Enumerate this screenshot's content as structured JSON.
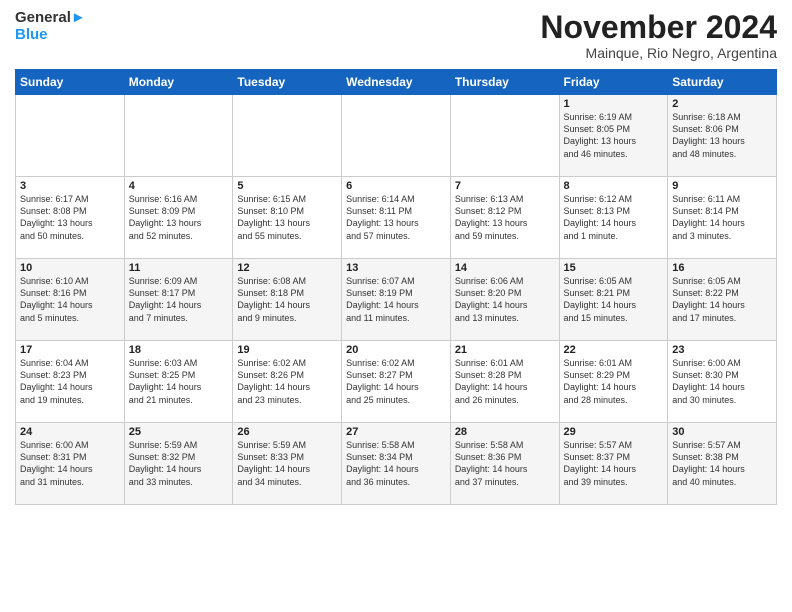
{
  "logo": {
    "line1": "General",
    "line2": "Blue"
  },
  "title": "November 2024",
  "subtitle": "Mainque, Rio Negro, Argentina",
  "days_header": [
    "Sunday",
    "Monday",
    "Tuesday",
    "Wednesday",
    "Thursday",
    "Friday",
    "Saturday"
  ],
  "weeks": [
    [
      {
        "day": "",
        "info": ""
      },
      {
        "day": "",
        "info": ""
      },
      {
        "day": "",
        "info": ""
      },
      {
        "day": "",
        "info": ""
      },
      {
        "day": "",
        "info": ""
      },
      {
        "day": "1",
        "info": "Sunrise: 6:19 AM\nSunset: 8:05 PM\nDaylight: 13 hours\nand 46 minutes."
      },
      {
        "day": "2",
        "info": "Sunrise: 6:18 AM\nSunset: 8:06 PM\nDaylight: 13 hours\nand 48 minutes."
      }
    ],
    [
      {
        "day": "3",
        "info": "Sunrise: 6:17 AM\nSunset: 8:08 PM\nDaylight: 13 hours\nand 50 minutes."
      },
      {
        "day": "4",
        "info": "Sunrise: 6:16 AM\nSunset: 8:09 PM\nDaylight: 13 hours\nand 52 minutes."
      },
      {
        "day": "5",
        "info": "Sunrise: 6:15 AM\nSunset: 8:10 PM\nDaylight: 13 hours\nand 55 minutes."
      },
      {
        "day": "6",
        "info": "Sunrise: 6:14 AM\nSunset: 8:11 PM\nDaylight: 13 hours\nand 57 minutes."
      },
      {
        "day": "7",
        "info": "Sunrise: 6:13 AM\nSunset: 8:12 PM\nDaylight: 13 hours\nand 59 minutes."
      },
      {
        "day": "8",
        "info": "Sunrise: 6:12 AM\nSunset: 8:13 PM\nDaylight: 14 hours\nand 1 minute."
      },
      {
        "day": "9",
        "info": "Sunrise: 6:11 AM\nSunset: 8:14 PM\nDaylight: 14 hours\nand 3 minutes."
      }
    ],
    [
      {
        "day": "10",
        "info": "Sunrise: 6:10 AM\nSunset: 8:16 PM\nDaylight: 14 hours\nand 5 minutes."
      },
      {
        "day": "11",
        "info": "Sunrise: 6:09 AM\nSunset: 8:17 PM\nDaylight: 14 hours\nand 7 minutes."
      },
      {
        "day": "12",
        "info": "Sunrise: 6:08 AM\nSunset: 8:18 PM\nDaylight: 14 hours\nand 9 minutes."
      },
      {
        "day": "13",
        "info": "Sunrise: 6:07 AM\nSunset: 8:19 PM\nDaylight: 14 hours\nand 11 minutes."
      },
      {
        "day": "14",
        "info": "Sunrise: 6:06 AM\nSunset: 8:20 PM\nDaylight: 14 hours\nand 13 minutes."
      },
      {
        "day": "15",
        "info": "Sunrise: 6:05 AM\nSunset: 8:21 PM\nDaylight: 14 hours\nand 15 minutes."
      },
      {
        "day": "16",
        "info": "Sunrise: 6:05 AM\nSunset: 8:22 PM\nDaylight: 14 hours\nand 17 minutes."
      }
    ],
    [
      {
        "day": "17",
        "info": "Sunrise: 6:04 AM\nSunset: 8:23 PM\nDaylight: 14 hours\nand 19 minutes."
      },
      {
        "day": "18",
        "info": "Sunrise: 6:03 AM\nSunset: 8:25 PM\nDaylight: 14 hours\nand 21 minutes."
      },
      {
        "day": "19",
        "info": "Sunrise: 6:02 AM\nSunset: 8:26 PM\nDaylight: 14 hours\nand 23 minutes."
      },
      {
        "day": "20",
        "info": "Sunrise: 6:02 AM\nSunset: 8:27 PM\nDaylight: 14 hours\nand 25 minutes."
      },
      {
        "day": "21",
        "info": "Sunrise: 6:01 AM\nSunset: 8:28 PM\nDaylight: 14 hours\nand 26 minutes."
      },
      {
        "day": "22",
        "info": "Sunrise: 6:01 AM\nSunset: 8:29 PM\nDaylight: 14 hours\nand 28 minutes."
      },
      {
        "day": "23",
        "info": "Sunrise: 6:00 AM\nSunset: 8:30 PM\nDaylight: 14 hours\nand 30 minutes."
      }
    ],
    [
      {
        "day": "24",
        "info": "Sunrise: 6:00 AM\nSunset: 8:31 PM\nDaylight: 14 hours\nand 31 minutes."
      },
      {
        "day": "25",
        "info": "Sunrise: 5:59 AM\nSunset: 8:32 PM\nDaylight: 14 hours\nand 33 minutes."
      },
      {
        "day": "26",
        "info": "Sunrise: 5:59 AM\nSunset: 8:33 PM\nDaylight: 14 hours\nand 34 minutes."
      },
      {
        "day": "27",
        "info": "Sunrise: 5:58 AM\nSunset: 8:34 PM\nDaylight: 14 hours\nand 36 minutes."
      },
      {
        "day": "28",
        "info": "Sunrise: 5:58 AM\nSunset: 8:36 PM\nDaylight: 14 hours\nand 37 minutes."
      },
      {
        "day": "29",
        "info": "Sunrise: 5:57 AM\nSunset: 8:37 PM\nDaylight: 14 hours\nand 39 minutes."
      },
      {
        "day": "30",
        "info": "Sunrise: 5:57 AM\nSunset: 8:38 PM\nDaylight: 14 hours\nand 40 minutes."
      }
    ]
  ]
}
